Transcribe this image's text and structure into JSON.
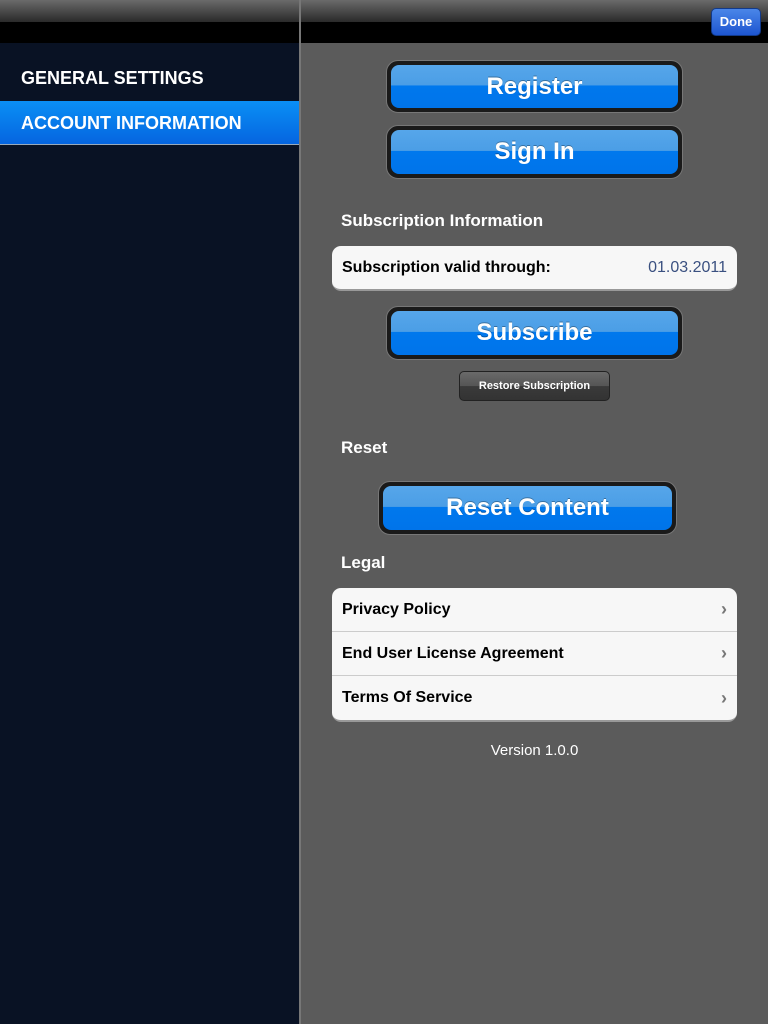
{
  "sidebar": {
    "items": [
      {
        "label": "GENERAL SETTINGS",
        "active": false
      },
      {
        "label": "ACCOUNT INFORMATION",
        "active": true
      }
    ]
  },
  "toolbar": {
    "done_label": "Done"
  },
  "main": {
    "register_label": "Register",
    "signin_label": "Sign In",
    "subscription_section": "Subscription Information",
    "subscription_row": {
      "label": "Subscription valid through:",
      "value": "01.03.2011"
    },
    "subscribe_label": "Subscribe",
    "restore_label": "Restore Subscription",
    "reset_section": "Reset",
    "reset_label": "Reset Content",
    "legal_section": "Legal",
    "legal_items": [
      "Privacy Policy",
      "End User License Agreement",
      "Terms Of Service"
    ],
    "version": "Version 1.0.0"
  },
  "colors": {
    "accent": "#0078ed",
    "sidebar_bg": "#091224",
    "main_bg": "#5b5b5b",
    "date_value": "#3a5080"
  }
}
